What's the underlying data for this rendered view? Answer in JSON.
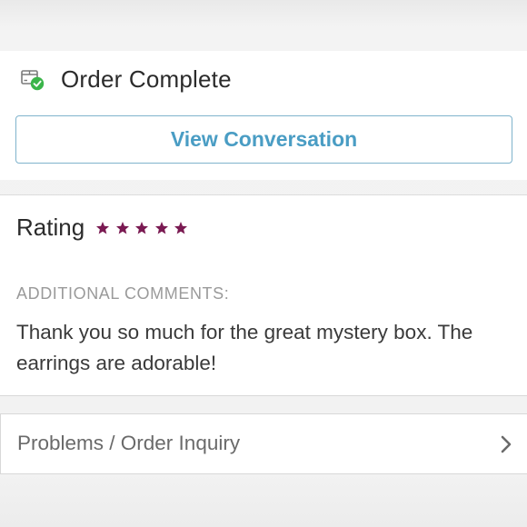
{
  "order": {
    "status_title": "Order Complete",
    "status_icon": "package-check-icon",
    "view_conversation_label": "View Conversation",
    "accent_color": "#4a9dc4",
    "success_color": "#3bb54a"
  },
  "rating": {
    "label": "Rating",
    "stars": 5,
    "max_stars": 5,
    "star_color": "#7a1a52"
  },
  "comments": {
    "label": "ADDITIONAL COMMENTS:",
    "text": "Thank you so much for the great mystery box. The earrings are adorable!"
  },
  "problems": {
    "label": "Problems / Order Inquiry",
    "icon": "chevron-right-icon"
  }
}
